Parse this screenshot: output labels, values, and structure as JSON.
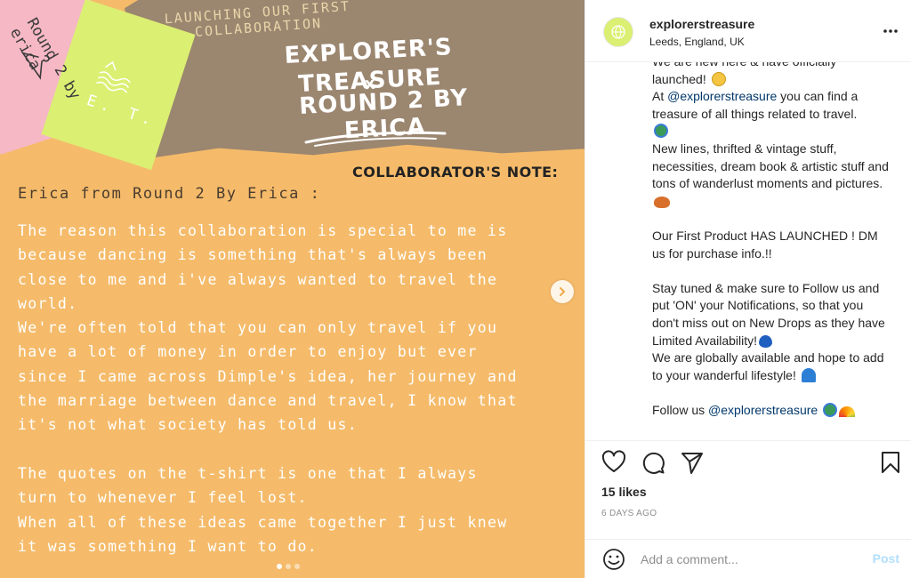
{
  "media": {
    "pink_note_text": "Round 2 by erica",
    "green_note_text": "E. T.",
    "launch_text": "LAUNCHING OUR FIRST COLLABORATION",
    "title": "EXPLORER'S TREASURE",
    "x": "x",
    "subtitle": "ROUND 2 BY ERICA",
    "note_label": "COLLABORATOR'S NOTE:",
    "author": "Erica from Round 2 By Erica :",
    "body": "The reason this collaboration is special to me is\nbecause dancing is something that's always been\nclose to me and i've always wanted to travel the\nworld.\nWe're often told that you can only travel if you\nhave a lot of money in order to enjoy but ever\nsince I came across Dimple's idea, her journey and\nthe marriage between dance and travel, I know that\nit's not what society has told us.\n\nThe quotes on the t-shirt is one that I always\nturn to whenever I feel lost.\nWhen all of these ideas came together I just knew\nit was something I want to do.",
    "carousel_dots": 3,
    "active_dot": 0
  },
  "post": {
    "username": "explorerstreasure",
    "location": "Leeds, England, UK",
    "caption": {
      "p1_a": "We are new here & have officially launched!",
      "p1_b": "At",
      "mention1": "@explorerstreasure",
      "p1_c": "you can find a treasure of all things related to travel.",
      "p1_d": "New lines, thrifted & vintage stuff, necessities, dream book & artistic stuff and tons of wanderlust moments and pictures.",
      "p2": "Our First Product HAS LAUNCHED ! DM us for purchase info.!!",
      "p3_a": "Stay tuned & make sure to Follow us and put 'ON' your Notifications, so that you don't miss out on New Drops as they have Limited Availability!",
      "p3_b": "We are globally available and hope to add to your wanderful lifestyle!",
      "p4_a": "Follow us",
      "mention2": "@explorerstreasure"
    },
    "likes": "15 likes",
    "date": "6 DAYS AGO",
    "comment_placeholder": "Add a comment...",
    "post_label": "Post"
  },
  "icons": [
    "more-icon",
    "heart-icon",
    "comment-icon",
    "share-icon",
    "bookmark-icon",
    "emoji-icon",
    "chevron-right-icon"
  ],
  "colors": {
    "media_bg": "#f5bb6a",
    "kraft": "#9b8670",
    "pink_note": "#f6b8c5",
    "green_note": "#dbef72",
    "mention": "#00376b",
    "post_disabled": "#b2dffc"
  }
}
